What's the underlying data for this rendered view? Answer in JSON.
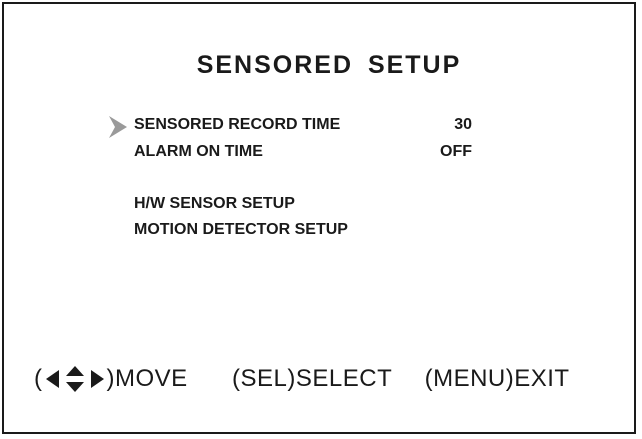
{
  "screen": {
    "title": "SENSORED  SETUP",
    "menu": [
      {
        "label": "SENSORED RECORD TIME",
        "value": "30",
        "selected": true
      },
      {
        "label": "ALARM ON TIME",
        "value": "OFF",
        "selected": false
      },
      {
        "label": "H/W SENSOR SETUP"
      },
      {
        "label": "MOTION DETECTOR SETUP"
      }
    ]
  },
  "footer": {
    "move_open": "(",
    "move_label": ")MOVE",
    "select_hint": "(SEL)SELECT",
    "exit_hint": "(MENU)EXIT"
  },
  "icons": {
    "cursor": "selection-arrow-icon",
    "move": "direction-arrows-icon"
  }
}
